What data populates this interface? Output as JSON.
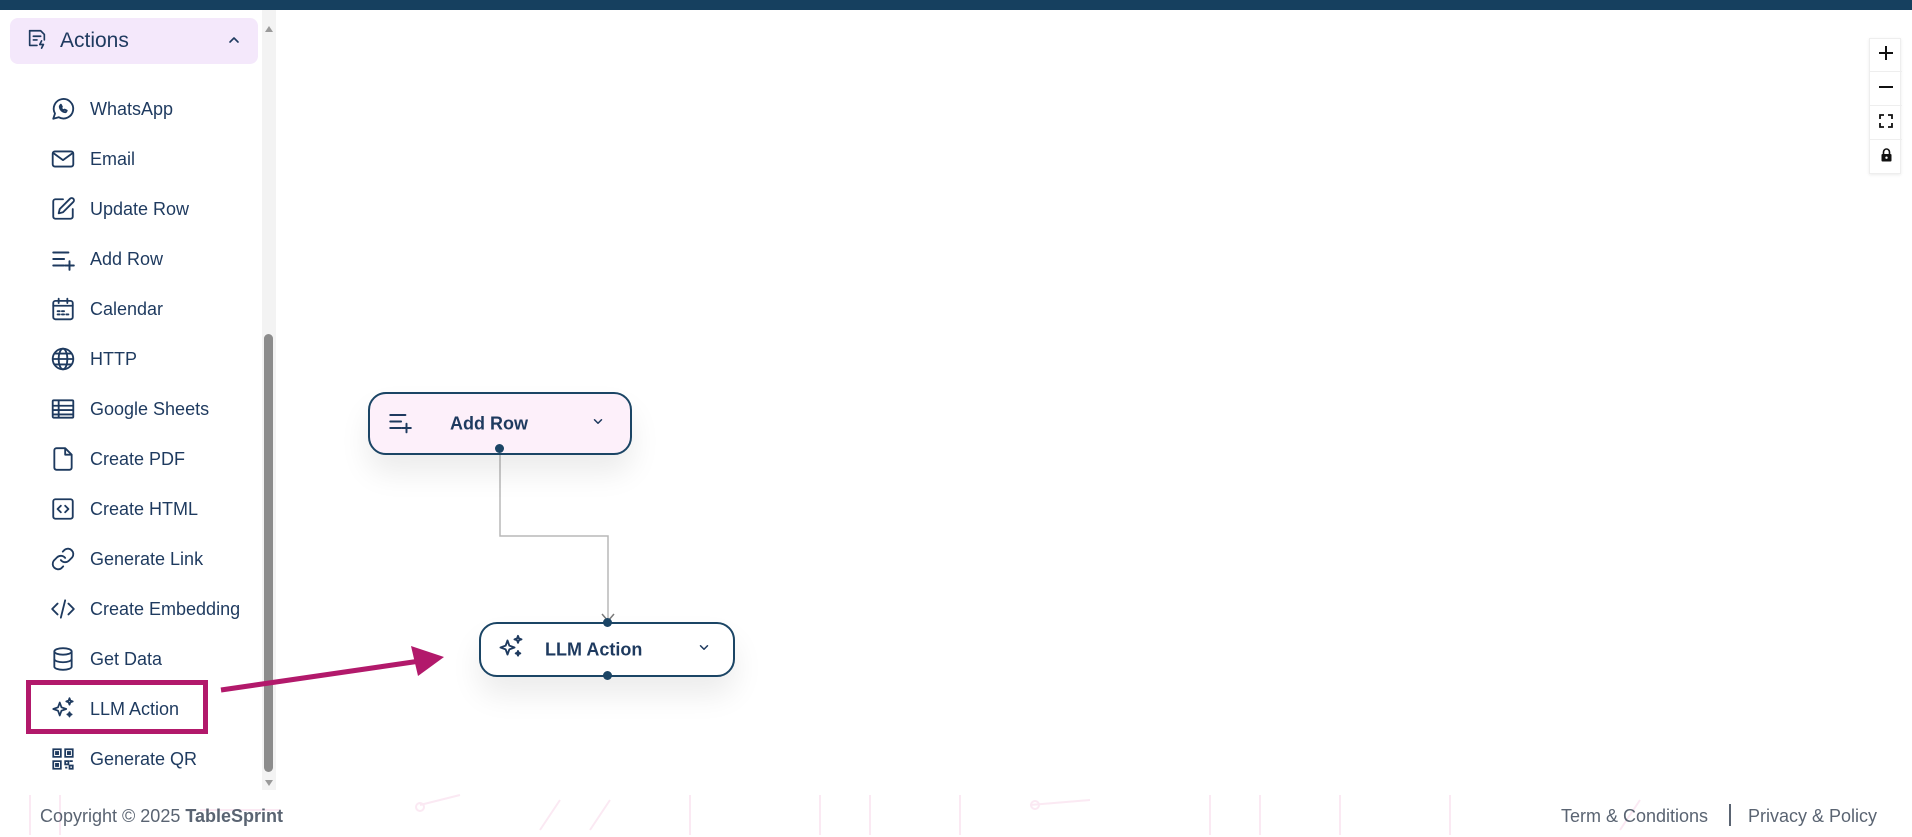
{
  "sidebar": {
    "section_title": "Actions",
    "items": [
      {
        "label": "WhatsApp",
        "icon": "whatsapp-icon"
      },
      {
        "label": "Email",
        "icon": "mail-icon"
      },
      {
        "label": "Update Row",
        "icon": "edit-icon"
      },
      {
        "label": "Add Row",
        "icon": "add-row-icon"
      },
      {
        "label": "Calendar",
        "icon": "calendar-icon"
      },
      {
        "label": "HTTP",
        "icon": "globe-icon"
      },
      {
        "label": "Google Sheets",
        "icon": "sheet-icon"
      },
      {
        "label": "Create PDF",
        "icon": "file-icon"
      },
      {
        "label": "Create HTML",
        "icon": "code-square-icon"
      },
      {
        "label": "Generate Link",
        "icon": "link-icon"
      },
      {
        "label": "Create Embedding",
        "icon": "code-icon"
      },
      {
        "label": "Get Data",
        "icon": "database-icon"
      },
      {
        "label": "LLM Action",
        "icon": "sparkles-icon"
      },
      {
        "label": "Generate QR",
        "icon": "qr-code-icon"
      }
    ],
    "highlighted_item": "LLM Action"
  },
  "canvas": {
    "nodes": [
      {
        "label": "Add Row",
        "icon": "add-row-icon"
      },
      {
        "label": "LLM Action",
        "icon": "sparkles-icon"
      }
    ]
  },
  "zoom_controls": [
    "plus-icon",
    "minus-icon",
    "fit-view-icon",
    "lock-icon"
  ],
  "footer": {
    "copyright_prefix": "Copyright © 2025 ",
    "brand": "TableSprint",
    "terms": "Term & Conditions",
    "privacy": "Privacy & Policy"
  },
  "colors": {
    "top_bar": "#16405f",
    "accent_highlight": "#b2196b",
    "text_primary": "#1e3a5f",
    "section_bg": "#f4e8fb",
    "node_bg_add_row": "#fdf0fa"
  }
}
